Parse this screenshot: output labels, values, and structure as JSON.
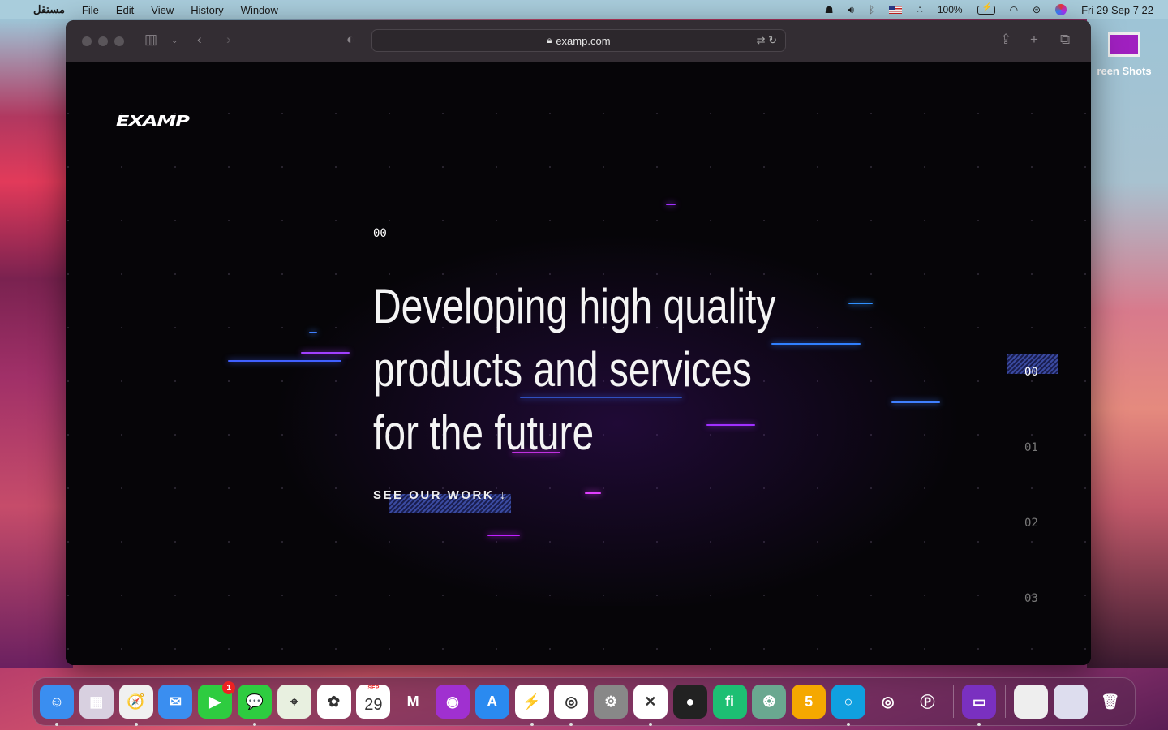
{
  "menubar": {
    "app": "مستقل",
    "items": [
      "File",
      "Edit",
      "View",
      "History",
      "Window"
    ],
    "battery": "100%",
    "datetime": "Fri 29 Sep  7 22"
  },
  "browser": {
    "url": "examp.com"
  },
  "page": {
    "logo": "EXAMP",
    "section_number": "00",
    "headline": [
      "Developing high quality",
      "products and services",
      "for the future"
    ],
    "cta": "SEE OUR WORK ↓",
    "pager": [
      "00",
      "01",
      "02",
      "03"
    ],
    "active_page": "00",
    "accent": "#3a4aa0"
  },
  "desktop": {
    "folder_label": "reen Shots"
  },
  "dock": {
    "items": [
      {
        "name": "finder",
        "bg": "#3a8ef0",
        "glyph": "☺",
        "run": true
      },
      {
        "name": "launchpad",
        "bg": "#d8d0e0",
        "glyph": "▦"
      },
      {
        "name": "safari",
        "bg": "#f0f0f0",
        "glyph": "🧭",
        "run": true
      },
      {
        "name": "mail",
        "bg": "#3a8ef0",
        "glyph": "✉"
      },
      {
        "name": "facetime",
        "bg": "#2ecc40",
        "glyph": "▶",
        "badge": "1"
      },
      {
        "name": "messages",
        "bg": "#2ecc40",
        "glyph": "💬",
        "run": true
      },
      {
        "name": "maps",
        "bg": "#e8f0e0",
        "glyph": "⌖"
      },
      {
        "name": "photos",
        "bg": "#fff",
        "glyph": "✿"
      },
      {
        "name": "calendar",
        "bg": "#fff",
        "glyph": "29",
        "month": "SEP"
      },
      {
        "name": "gmail",
        "bg": "transparent",
        "glyph": "M"
      },
      {
        "name": "podcasts",
        "bg": "#a030d0",
        "glyph": "◉"
      },
      {
        "name": "app-store",
        "bg": "#2a8af0",
        "glyph": "A"
      },
      {
        "name": "messenger",
        "bg": "#fff",
        "glyph": "⚡",
        "run": true
      },
      {
        "name": "chrome",
        "bg": "#fff",
        "glyph": "◎",
        "run": true
      },
      {
        "name": "system-preferences",
        "bg": "#888",
        "glyph": "⚙"
      },
      {
        "name": "vscode",
        "bg": "#fff",
        "glyph": "✕",
        "run": true
      },
      {
        "name": "recorder",
        "bg": "#222",
        "glyph": "●"
      },
      {
        "name": "fiverr",
        "bg": "#1dbf73",
        "glyph": "fi"
      },
      {
        "name": "chatgpt",
        "bg": "#6aa890",
        "glyph": "❂"
      },
      {
        "name": "app-5",
        "bg": "#f5a800",
        "glyph": "5"
      },
      {
        "name": "app-circle",
        "bg": "#10a0e0",
        "glyph": "○",
        "run": true
      },
      {
        "name": "podcast-app",
        "bg": "transparent",
        "glyph": "◎"
      },
      {
        "name": "app-p",
        "bg": "transparent",
        "glyph": "Ⓟ"
      },
      {
        "sep": true
      },
      {
        "name": "disk-utility",
        "bg": "#7a30c0",
        "glyph": "▭",
        "run": true
      },
      {
        "sep": true
      },
      {
        "name": "window-thumb-chrome",
        "bg": "#eee",
        "glyph": ""
      },
      {
        "name": "window-thumb-app",
        "bg": "#dde",
        "glyph": ""
      },
      {
        "name": "trash",
        "bg": "transparent",
        "glyph": "🗑"
      }
    ]
  }
}
